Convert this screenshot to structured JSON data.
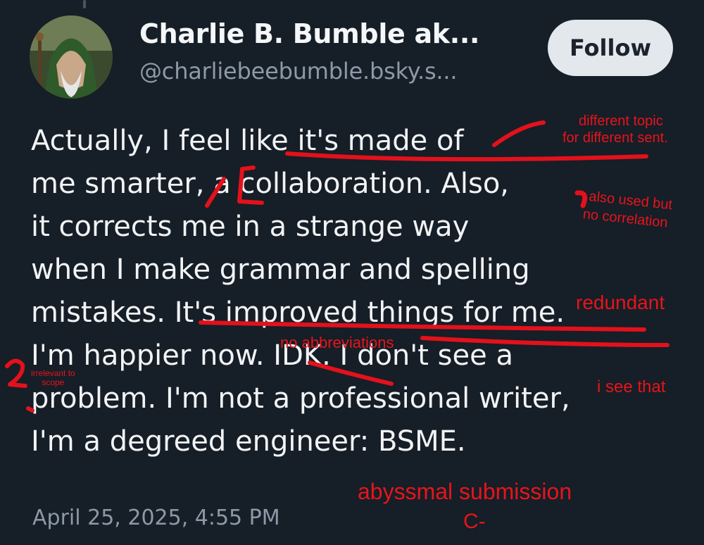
{
  "post": {
    "author_name": "Charlie B. Bumble ak...",
    "author_handle": "@charliebeebumble.bsky.s...",
    "follow_label": "Follow",
    "lines": [
      "Actually, I feel like it's made of",
      "me smarter, a collaboration. Also,",
      "it corrects me in a strange way",
      "when I make grammar and spelling",
      "mistakes. It's improved things for me.",
      "I'm happier now. IDK. I don't see a",
      "problem. I'm not a professional writer,",
      "I'm a degreed engineer: BSME."
    ],
    "timestamp": "April 25, 2025, 4:55 PM"
  },
  "annotations": {
    "different_topic_line1": "different topic",
    "different_topic_line2": "for different sent.",
    "also_used_line1": "also used but",
    "also_used_line2": "no correlation",
    "redundant": "redundant",
    "no_abbreviations": "no abbreviations",
    "irrelevant_line1": "irrelevant to",
    "irrelevant_line2": "scope",
    "question_mark": "?",
    "i_see_that": "i see that",
    "abyssmal": "abyssmal submission",
    "grade": "C-"
  },
  "colors": {
    "background": "#161e27",
    "annotation_red": "#e3111b",
    "muted_text": "#8c99a8"
  }
}
